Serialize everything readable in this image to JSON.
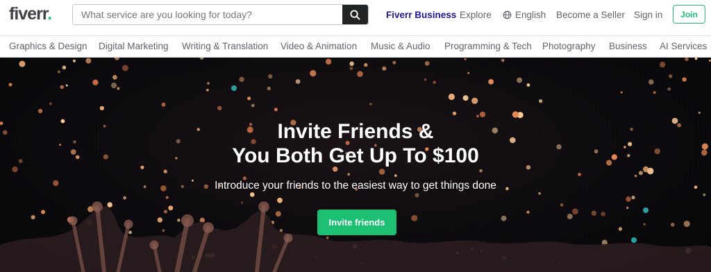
{
  "header": {
    "logo_text": "fiverr",
    "logo_dot": ".",
    "search_placeholder": "What service are you looking for today?",
    "nav": {
      "business": "Fiverr Business",
      "explore": "Explore",
      "language": "English",
      "become_seller": "Become a Seller",
      "sign_in": "Sign in",
      "join": "Join"
    }
  },
  "categories": [
    "Graphics & Design",
    "Digital Marketing",
    "Writing & Translation",
    "Video & Animation",
    "Music & Audio",
    "Programming & Tech",
    "Photography",
    "Business",
    "AI Services"
  ],
  "hero": {
    "title_line1": "Invite Friends &",
    "title_line2": "You Both Get Up To $100",
    "subtitle": "Introduce your friends to the easiest way to get things done",
    "cta": "Invite friends"
  },
  "colors": {
    "brand_green": "#1dbf73",
    "business_blue": "#1e1692",
    "text_gray": "#62646a"
  },
  "icons": {
    "search": "search-icon",
    "language": "globe-icon"
  }
}
